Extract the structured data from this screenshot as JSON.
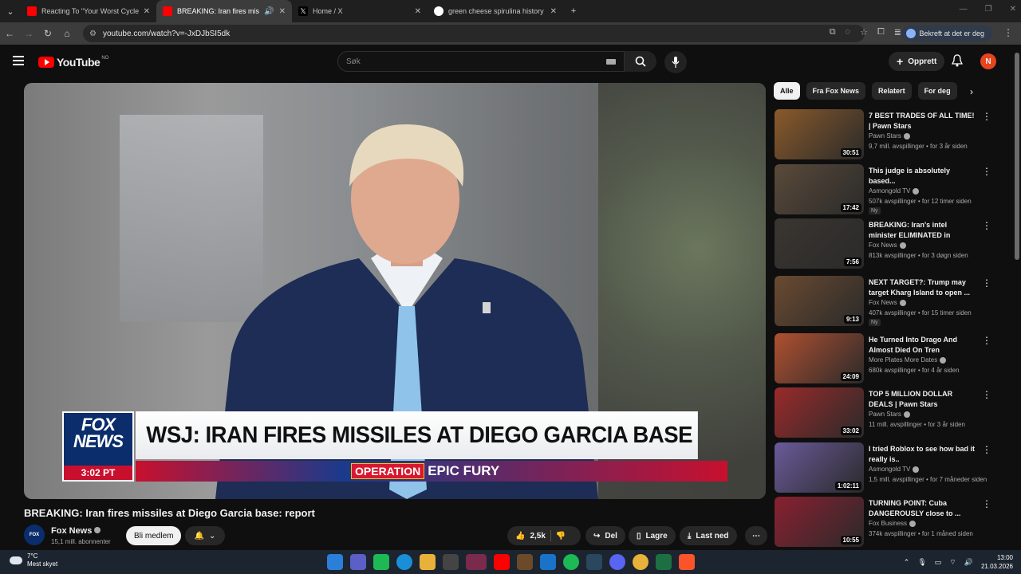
{
  "browser": {
    "tabs": [
      {
        "title": "Reacting To \"Your Worst Cycle\"",
        "favicon_color": "#ff0000",
        "active": false
      },
      {
        "title": "BREAKING: Iran fires missile",
        "favicon_color": "#ff0000",
        "active": true
      },
      {
        "title": "Home / X",
        "favicon_color": "#000000",
        "active": false
      },
      {
        "title": "green cheese spirulina history",
        "favicon_color": "#4285f4",
        "active": false
      }
    ],
    "url": "youtube.com/watch?v=-JxDJbSI5dk",
    "confirm_label": "Bekreft at det er deg"
  },
  "youtube": {
    "logo_text": "YouTube",
    "country_code": "NO",
    "search_placeholder": "Søk",
    "create_label": "Opprett",
    "avatar_letter": "N"
  },
  "video": {
    "banner": {
      "brand_line1": "FOX",
      "brand_line2": "NEWS",
      "time": "3:02 PT",
      "headline": "WSJ: IRAN FIRES MISSILES AT DIEGO GARCIA BASE",
      "operation": "OPERATION",
      "operation_name": "EPIC FURY"
    },
    "title": "BREAKING: Iran fires missiles at Diego Garcia base: report",
    "channel": "Fox News",
    "subscribers": "15,1 mill. abonnenter",
    "join_label": "Bli medlem",
    "likes": "2,5k",
    "share_label": "Del",
    "save_label": "Lagre",
    "download_label": "Last ned"
  },
  "chips": [
    "Alle",
    "Fra Fox News",
    "Relatert",
    "For deg"
  ],
  "recommendations": [
    {
      "title": "7 BEST TRADES OF ALL TIME! | Pawn Stars",
      "channel": "Pawn Stars",
      "meta": "9,7 mill. avspillinger • for 3 år siden",
      "duration": "30:51",
      "thumb": "#8a5a2a",
      "new": ""
    },
    {
      "title": "This judge is absolutely based...",
      "channel": "Asmongold TV",
      "meta": "507k avspillinger • for 12 timer siden",
      "duration": "17:42",
      "thumb": "#5a4a3a",
      "new": "Ny"
    },
    {
      "title": "BREAKING: Iran's intel minister ELIMINATED in overnight ...",
      "channel": "Fox News",
      "meta": "813k avspillinger • for 3 døgn siden",
      "duration": "7:56",
      "thumb": "#3a3530",
      "new": ""
    },
    {
      "title": "NEXT TARGET?: Trump may target Kharg Island to open ...",
      "channel": "Fox News",
      "meta": "407k avspillinger • for 15 timer siden",
      "duration": "9:13",
      "thumb": "#6a4a30",
      "new": "Ny"
    },
    {
      "title": "He Turned Into Drago And Almost Died On Tren",
      "channel": "More Plates More Dates",
      "meta": "680k avspillinger • for 4 år siden",
      "duration": "24:09",
      "thumb": "#b05030",
      "new": ""
    },
    {
      "title": "TOP 5 MILLION DOLLAR DEALS | Pawn Stars",
      "channel": "Pawn Stars",
      "meta": "11 mill. avspillinger • for 3 år siden",
      "duration": "33:02",
      "thumb": "#9a2a2a",
      "new": ""
    },
    {
      "title": "I tried Roblox to see how bad it really is..",
      "channel": "Asmongold TV",
      "meta": "1,5 mill. avspillinger • for 7 måneder siden",
      "duration": "1:02:11",
      "thumb": "#6a5a9a",
      "new": ""
    },
    {
      "title": "TURNING POINT: Cuba DANGEROUSLY close to ...",
      "channel": "Fox Business",
      "meta": "374k avspillinger • for 1 måned siden",
      "duration": "10:55",
      "thumb": "#8a2030",
      "new": ""
    }
  ],
  "taskbar": {
    "temp": "7°C",
    "weather": "Mest skyet",
    "time": "13:00",
    "date": "21.03.2026"
  }
}
